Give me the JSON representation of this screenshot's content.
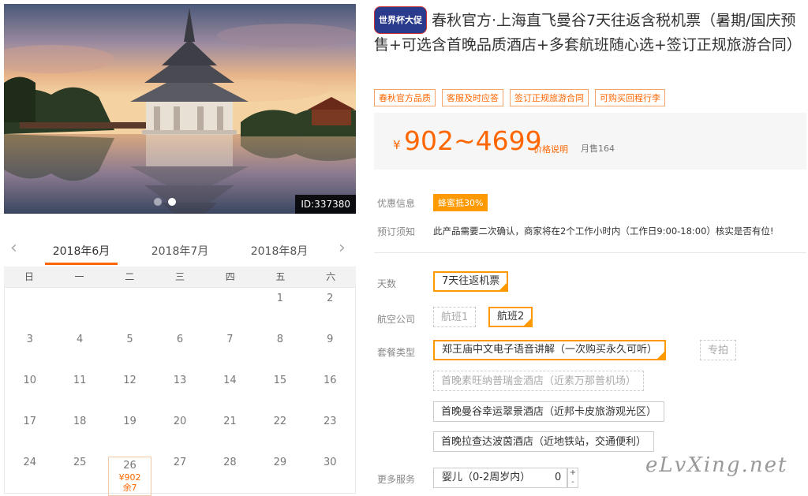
{
  "hero": {
    "id_label": "ID:337380",
    "slide_count": 2,
    "active_slide": 2
  },
  "calendar": {
    "prev_icon": "chevron-left-icon",
    "next_icon": "chevron-right-icon",
    "months": [
      "2018年6月",
      "2018年7月",
      "2018年8月"
    ],
    "active_month": 0,
    "weekdays": [
      "日",
      "一",
      "二",
      "三",
      "四",
      "五",
      "六"
    ],
    "days": [
      {
        "n": ""
      },
      {
        "n": ""
      },
      {
        "n": ""
      },
      {
        "n": ""
      },
      {
        "n": ""
      },
      {
        "n": "1"
      },
      {
        "n": "2"
      },
      {
        "n": "3"
      },
      {
        "n": "4"
      },
      {
        "n": "5"
      },
      {
        "n": "6"
      },
      {
        "n": "7"
      },
      {
        "n": "8"
      },
      {
        "n": "9"
      },
      {
        "n": "10"
      },
      {
        "n": "11"
      },
      {
        "n": "12"
      },
      {
        "n": "13"
      },
      {
        "n": "14"
      },
      {
        "n": "15"
      },
      {
        "n": "16"
      },
      {
        "n": "17"
      },
      {
        "n": "18"
      },
      {
        "n": "19"
      },
      {
        "n": "20"
      },
      {
        "n": "21"
      },
      {
        "n": "22"
      },
      {
        "n": "23"
      },
      {
        "n": "24"
      },
      {
        "n": "25"
      },
      {
        "n": "26",
        "price": "¥902",
        "stock": "余7"
      },
      {
        "n": "27"
      },
      {
        "n": "28"
      },
      {
        "n": "29"
      },
      {
        "n": "30"
      }
    ]
  },
  "product": {
    "promo_badge": "世界杯大促",
    "title": "春秋官方·上海直飞曼谷7天往返含税机票（暑期/国庆预售+可选含首晚品质酒店+多套航班随心选+签订正规旅游合同）",
    "tags": [
      "春秋官方品质",
      "客服及时应答",
      "签订正规旅游合同",
      "可购买回程行李"
    ],
    "price_symbol": "¥",
    "price": "902~4699",
    "price_explain": "价格说明",
    "monthly_sales": "月售164"
  },
  "info": {
    "discount_label": "优惠信息",
    "discount_value": "蜂蜜抵30%",
    "notice_label": "预订须知",
    "notice_text": "此产品需要二次确认，商家将在2个工作小时内（工作日9:00-18:00）核实是否有位!"
  },
  "options": {
    "days_label": "天数",
    "days": "7天往返机票",
    "airline_label": "航空公司",
    "flight1": "航班1",
    "flight2": "航班2",
    "package_label": "套餐类型",
    "package1": "郑王庙中文电子语音讲解（一次购买永久可听）",
    "package_special": "专拍",
    "package2": "首晚素旺纳普瑞金酒店（近素万那普机场）",
    "package3": "首晚曼谷幸运翠景酒店（近邦卡皮旅游观光区）",
    "package4": "首晚拉查达波茵酒店（近地铁站，交通便利）",
    "more_label": "更多服务",
    "stepper_label": "婴儿（0-2周岁内）",
    "stepper_value": "0",
    "plus": "+",
    "minus": "-"
  },
  "watermark": "eLvXing.net"
}
